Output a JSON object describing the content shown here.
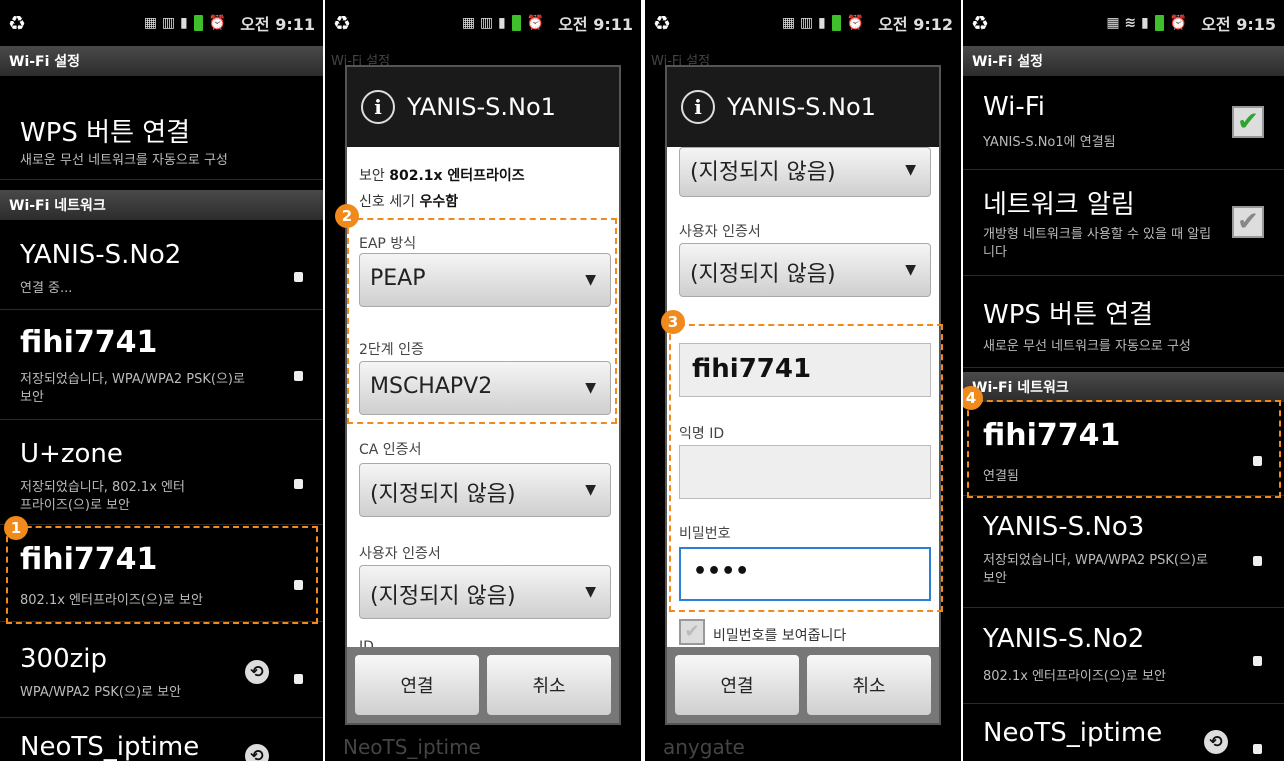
{
  "status": {
    "t1": "오전 9:11",
    "t2": "오전 9:11",
    "t3": "오전 9:12",
    "t4": "오전 9:15"
  },
  "p1": {
    "section": "Wi-Fi 설정",
    "wps_title": "WPS 버튼 연결",
    "wps_sub": "새로운 무선 네트워크를 자동으로 구성",
    "networks_header": "Wi-Fi 네트워크",
    "networks": [
      {
        "name": "YANIS-S.No2",
        "status": "연결 중..."
      },
      {
        "name": "fihi7741",
        "status": "저장되었습니다, WPA/WPA2 PSK(으)로 보안"
      },
      {
        "name": "U+zone",
        "status": "저장되었습니다, 802.1x 엔터프라이즈(으)로 보안"
      },
      {
        "name": "fihi7741",
        "status": "802.1x 엔터프라이즈(으)로 보안"
      },
      {
        "name": "300zip",
        "status": "WPA/WPA2 PSK(으)로 보안"
      },
      {
        "name": "NeoTS_iptime",
        "status": ""
      }
    ],
    "badge": "1"
  },
  "p2": {
    "ghost_top": "Wi-Fi 설정",
    "ghost_bottom": "NeoTS_iptime",
    "title": "YANIS-S.No1",
    "security_label": "보안",
    "security_value": "802.1x 엔터프라이즈",
    "signal_label": "신호 세기",
    "signal_value": "우수함",
    "eap_label": "EAP 방식",
    "eap_value": "PEAP",
    "phase2_label": "2단계 인증",
    "phase2_value": "MSCHAPV2",
    "ca_label": "CA 인증서",
    "ca_value": "(지정되지 않음)",
    "user_cert_label": "사용자 인증서",
    "user_cert_value": "(지정되지 않음)",
    "id_label": "ID",
    "connect": "연결",
    "cancel": "취소",
    "badge": "2"
  },
  "p3": {
    "ghost_top": "Wi-Fi 설정",
    "ghost_bottom": "anygate",
    "title": "YANIS-S.No1",
    "top_select_value": "(지정되지 않음)",
    "user_cert_label": "사용자 인증서",
    "user_cert_value": "(지정되지 않음)",
    "identity_value": "fihi7741",
    "anon_label": "익명 ID",
    "anon_value": "",
    "password_label": "비밀번호",
    "password_value": "••••",
    "show_password": "비밀번호를 보여줍니다",
    "connect": "연결",
    "cancel": "취소",
    "badge": "3"
  },
  "p4": {
    "section": "Wi-Fi 설정",
    "wifi_title": "Wi-Fi",
    "wifi_sub": "YANIS-S.No1에 연결됨",
    "notify_title": "네트워크 알림",
    "notify_sub": "개방형 네트워크를 사용할 수 있을 때 알립니다",
    "wps_title": "WPS 버튼 연결",
    "wps_sub": "새로운 무선 네트워크를 자동으로 구성",
    "networks_header": "Wi-Fi 네트워크",
    "networks": [
      {
        "name": "fihi7741",
        "status": "연결됨"
      },
      {
        "name": "YANIS-S.No3",
        "status": "저장되었습니다, WPA/WPA2 PSK(으)로 보안"
      },
      {
        "name": "YANIS-S.No2",
        "status": "802.1x 엔터프라이즈(으)로 보안"
      },
      {
        "name": "NeoTS_iptime",
        "status": ""
      }
    ],
    "badge": "4"
  },
  "colors": {
    "accent": "#f08a1c",
    "signal": "#8bd12a",
    "focus": "#2d7fd6"
  }
}
